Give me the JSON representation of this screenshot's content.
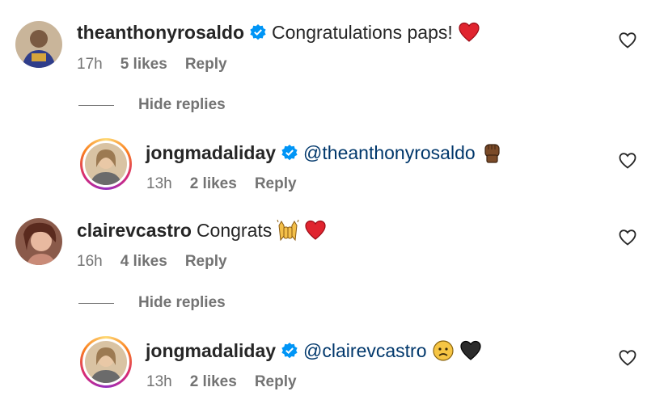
{
  "comments": [
    {
      "username": "theanthonyrosaldo",
      "text": "Congratulations paps!",
      "emoji": [
        "red-heart"
      ],
      "time": "17h",
      "likes": "5 likes",
      "reply": "Reply",
      "verified": true
    },
    {
      "username": "jongmadaliday",
      "mention": "@theanthonyrosaldo",
      "emoji": [
        "raised-fist-dark-skin"
      ],
      "time": "13h",
      "likes": "2 likes",
      "reply": "Reply",
      "verified": true
    },
    {
      "username": "clairevcastro",
      "text": "Congrats",
      "emoji": [
        "raising-hands",
        "red-heart"
      ],
      "time": "16h",
      "likes": "4 likes",
      "reply": "Reply",
      "verified": false
    },
    {
      "username": "jongmadaliday",
      "mention": "@clairevcastro",
      "emoji": [
        "slightly-frowning-face",
        "black-heart"
      ],
      "time": "13h",
      "likes": "2 likes",
      "reply": "Reply",
      "verified": true
    }
  ],
  "hide_replies": [
    "Hide replies",
    "Hide replies"
  ],
  "colors": {
    "text": "#262626",
    "meta": "#737373",
    "mention": "#00376b",
    "verified": "#0095f6",
    "heart": "#ed4956"
  }
}
